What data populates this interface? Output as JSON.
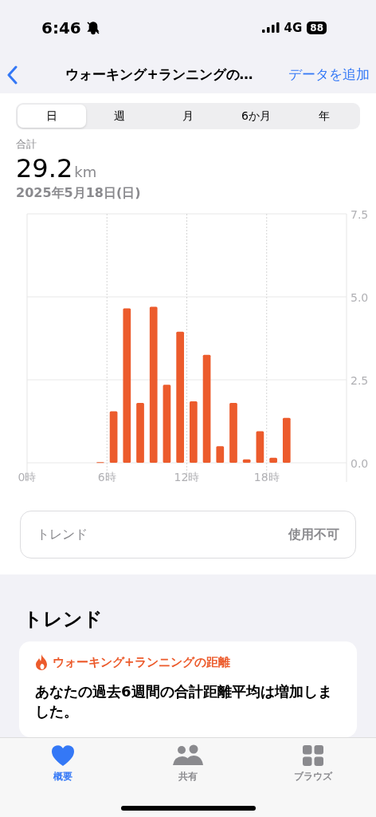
{
  "status_bar": {
    "time": "6:46",
    "network": "4G",
    "battery": "88"
  },
  "nav": {
    "title": "ウォーキング+ランニングの…",
    "action": "データを追加"
  },
  "segments": [
    {
      "label": "日",
      "selected": true
    },
    {
      "label": "週",
      "selected": false
    },
    {
      "label": "月",
      "selected": false
    },
    {
      "label": "6か月",
      "selected": false
    },
    {
      "label": "年",
      "selected": false
    }
  ],
  "summary": {
    "label": "合計",
    "value": "29.2",
    "unit": "km",
    "date": "2025年5月18日(日)"
  },
  "chart_data": {
    "type": "bar",
    "x": [
      5.5,
      6.5,
      7.5,
      8.5,
      9.5,
      10.5,
      11.5,
      12.5,
      13.5,
      14.5,
      15.5,
      16.5,
      17.5,
      18.5,
      19.5
    ],
    "xlim": [
      0,
      24
    ],
    "grid": true,
    "series": [
      {
        "color": "#ec5b2c",
        "values": [
          0.02,
          1.55,
          4.65,
          1.8,
          4.7,
          2.35,
          3.95,
          1.85,
          3.25,
          0.5,
          1.8,
          0.1,
          0.95,
          0.15,
          1.35
        ]
      }
    ],
    "ylim": [
      0,
      7.5
    ],
    "yticks": [
      {
        "value": 0,
        "label": "0.0"
      },
      {
        "value": 2.5,
        "label": "2.5"
      },
      {
        "value": 5,
        "label": "5.0"
      },
      {
        "value": 7.5,
        "label": "7.5"
      }
    ],
    "xticks": [
      {
        "value": 0,
        "label": "0時"
      },
      {
        "value": 6,
        "label": "6時"
      },
      {
        "value": 12,
        "label": "12時"
      },
      {
        "value": 18,
        "label": "18時"
      }
    ]
  },
  "trend_row": {
    "label": "トレンド",
    "value": "使用不可"
  },
  "trends": {
    "heading": "トレンド",
    "card": {
      "title": "ウォーキング+ランニングの距離",
      "text": "あなたの過去6週間の合計距離平均は増加しました。"
    }
  },
  "tab_bar": [
    {
      "label": "概要",
      "kind": "heart",
      "selected": true
    },
    {
      "label": "共有",
      "kind": "people",
      "selected": false
    },
    {
      "label": "ブラウズ",
      "kind": "grid",
      "selected": false
    }
  ]
}
